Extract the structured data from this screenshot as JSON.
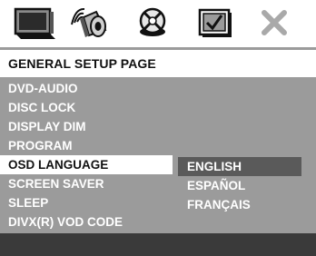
{
  "icons": [
    {
      "name": "general-setup-icon",
      "selected": true
    },
    {
      "name": "audio-speaker-icon",
      "selected": false
    },
    {
      "name": "video-setup-icon",
      "selected": false
    },
    {
      "name": "preferences-icon",
      "selected": false
    },
    {
      "name": "exit-icon",
      "selected": false
    }
  ],
  "header": {
    "title": "GENERAL SETUP PAGE"
  },
  "menu": {
    "items": [
      {
        "label": "DVD-AUDIO"
      },
      {
        "label": "DISC LOCK"
      },
      {
        "label": "DISPLAY DIM"
      },
      {
        "label": "PROGRAM"
      },
      {
        "label": "OSD LANGUAGE",
        "selected": true
      },
      {
        "label": "SCREEN SAVER"
      },
      {
        "label": "SLEEP"
      },
      {
        "label": "DIVX(R) VOD CODE"
      }
    ]
  },
  "submenu": {
    "options": [
      {
        "label": "ENGLISH",
        "selected": true
      },
      {
        "label": "ESPAÑOL"
      },
      {
        "label": "FRANÇAIS"
      }
    ]
  },
  "colors": {
    "background": "#9b9b9b",
    "highlight": "#ffffff",
    "submenu_highlight": "#5a5a5a",
    "footer": "#3a3a3a"
  }
}
